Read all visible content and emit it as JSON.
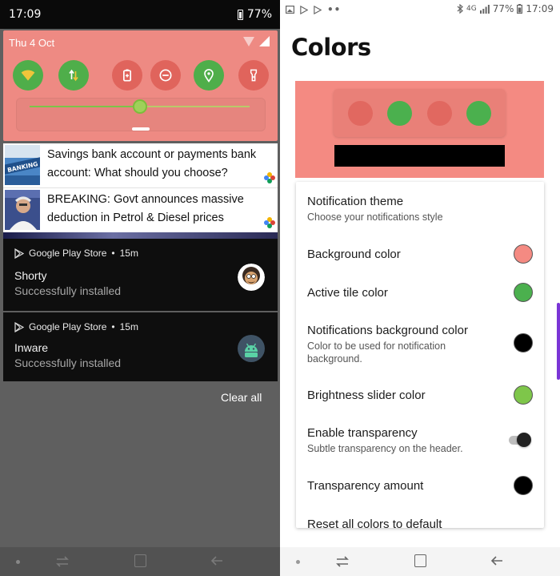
{
  "left_screen": {
    "status_bar": {
      "time": "17:09",
      "battery": "77%"
    },
    "quick_settings": {
      "date": "Thu 4 Oct",
      "tiles": [
        {
          "name": "wifi",
          "state": "on"
        },
        {
          "name": "mobile-data",
          "state": "on"
        },
        {
          "name": "battery-saver",
          "state": "off"
        },
        {
          "name": "do-not-disturb",
          "state": "off"
        },
        {
          "name": "location",
          "state": "on"
        },
        {
          "name": "flashlight",
          "state": "off"
        }
      ],
      "brightness_level": 0.5,
      "colors": {
        "background": "#ee8a83",
        "active_tile": "#4fae4a",
        "inactive_tile": "#e0645c",
        "slider": "#7dc449"
      }
    },
    "news": [
      {
        "text": "Savings bank account or payments bank account: What should you choose?",
        "thumb_label": "BANKING"
      },
      {
        "text": "BREAKING: Govt announces massive deduction in Petrol & Diesel prices"
      }
    ],
    "notifications": [
      {
        "app": "Google Play Store",
        "time": "15m",
        "title": "Shorty",
        "subtitle": "Successfully installed",
        "icon": "shorty-app-icon"
      },
      {
        "app": "Google Play Store",
        "time": "15m",
        "title": "Inware",
        "subtitle": "Successfully installed",
        "icon": "android-app-icon"
      }
    ],
    "clear_all_label": "Clear all"
  },
  "right_screen": {
    "status_bar": {
      "network": "4G",
      "battery": "77%",
      "time": "17:09"
    },
    "title": "Colors",
    "preview": {
      "background": "#f48a82",
      "active_tile": "#4bb04e",
      "inactive_tile": "#e16860",
      "bar": "#000000"
    },
    "settings": [
      {
        "label": "Notification theme",
        "description": "Choose your notifications style"
      },
      {
        "label": "Background color",
        "swatch": "#f48a82"
      },
      {
        "label": "Active tile color",
        "swatch": "#4bb04e"
      },
      {
        "label": "Notifications background color",
        "description": "Color to be used for notification background.",
        "swatch": "#000000"
      },
      {
        "label": "Brightness slider color",
        "swatch": "#7ec64a"
      },
      {
        "label": "Enable transparency",
        "description": "Subtle transparency on the header.",
        "toggle": "on"
      },
      {
        "label": "Transparency amount",
        "swatch": "#000000"
      },
      {
        "label": "Reset all colors to default"
      }
    ],
    "accent": "#7a35d6"
  }
}
